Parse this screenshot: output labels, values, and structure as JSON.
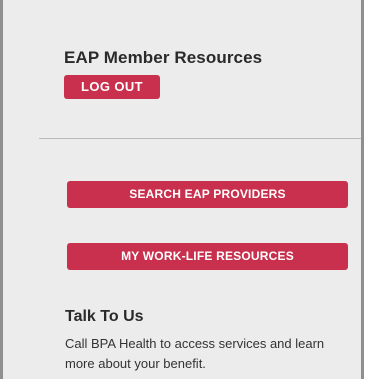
{
  "eap": {
    "title": "EAP Member Resources",
    "logout_label": "LOG OUT"
  },
  "actions": {
    "search_providers_label": "SEARCH EAP PROVIDERS",
    "work_life_label": "MY WORK-LIFE RESOURCES"
  },
  "talk": {
    "heading": "Talk To Us",
    "body": "Call BPA Health to access services and learn more about your benefit."
  },
  "colors": {
    "accent": "#c8304e",
    "panel_background": "#ececec",
    "border": "#8f8f8f"
  }
}
